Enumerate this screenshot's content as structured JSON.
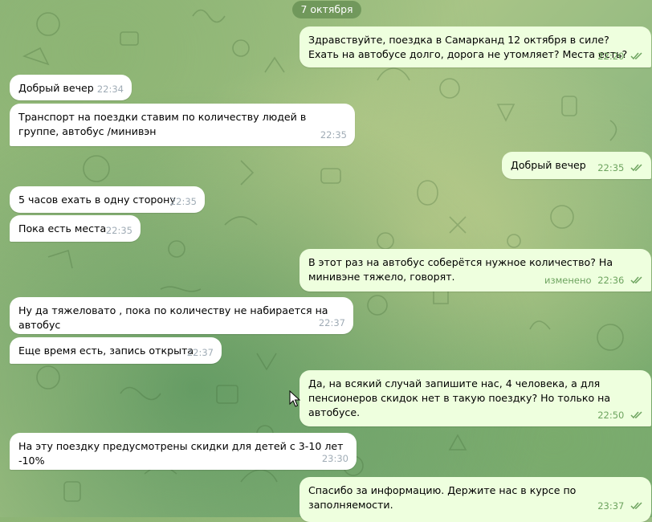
{
  "date_separator": "7 октября",
  "messages": [
    {
      "dir": "out",
      "text": "Здравствуйте, поездка в Самарканд 12 октября в силе?  Ехать на автобусе долго, дорога не утомляет? Места есть?",
      "time": "22:20",
      "read": true
    },
    {
      "dir": "in",
      "text": "Добрый вечер",
      "time": "22:34"
    },
    {
      "dir": "in",
      "text": "Транспорт на поездки ставим по количеству людей в группе, автобус /минивэн",
      "time": "22:35"
    },
    {
      "dir": "out",
      "text": "Добрый вечер",
      "time": "22:35",
      "read": true
    },
    {
      "dir": "in",
      "text": "5 часов ехать в одну сторону",
      "time": "22:35"
    },
    {
      "dir": "in",
      "text": "Пока есть места",
      "time": "22:35"
    },
    {
      "dir": "out",
      "text": "В этот раз на автобус соберётся нужное количество? На минивэне тяжело, говорят.",
      "time": "22:36",
      "edited": "изменено",
      "read": true
    },
    {
      "dir": "in",
      "text": "Ну да тяжеловато , пока по количеству не набирается на автобус",
      "time": "22:37"
    },
    {
      "dir": "in",
      "text": "Еще время есть, запись открыта",
      "time": "22:37"
    },
    {
      "dir": "out",
      "text": "Да, на всякий случай запишите нас, 4 человека, а для пенсионеров скидок нет в такую поездку? Но только на автобусе.",
      "time": "22:50",
      "read": true
    },
    {
      "dir": "in",
      "text": "На эту поездку предусмотрены скидки для детей с 3-10 лет -10%",
      "time": "23:30"
    },
    {
      "dir": "out",
      "text": "Спасибо за информацию.  Держите нас в курсе по заполняемости.",
      "time": "23:37",
      "read": true
    }
  ]
}
